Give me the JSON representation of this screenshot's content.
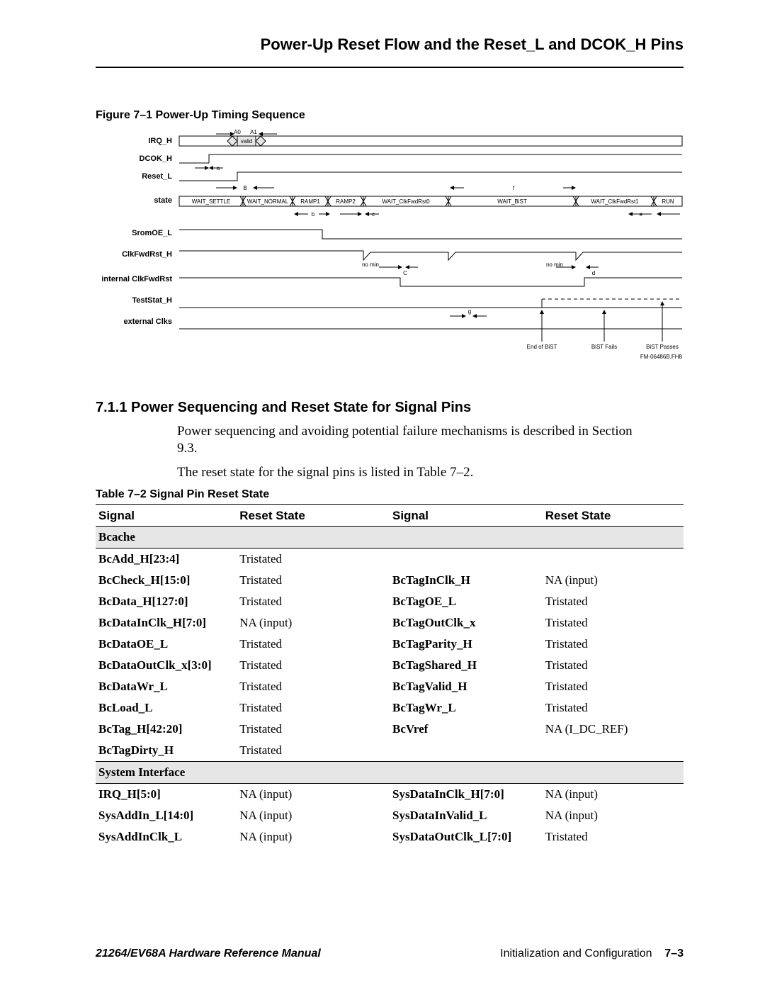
{
  "header": {
    "title": "Power-Up Reset Flow and the Reset_L and DCOK_H Pins"
  },
  "figure": {
    "caption": "Figure 7–1  Power-Up Timing Sequence",
    "signals": [
      "IRQ_H",
      "DCOK_H",
      "Reset_L",
      "state",
      "SromOE_L",
      "ClkFwdRst_H",
      "internal ClkFwdRst",
      "TestStat_H",
      "external Clks"
    ],
    "state_boxes": [
      "WAIT_SETTLE",
      "WAIT_NORMAL",
      "RAMP1",
      "RAMP2",
      "WAIT_ClkFwdRst0",
      "WAIT_BiST",
      "WAIT_ClkFwdRst1",
      "RUN"
    ],
    "irq_inner": "valid",
    "markers": {
      "A0": "A0",
      "A1": "A1",
      "a": "a",
      "B": "B",
      "b": "b",
      "c": "c",
      "C": "C",
      "d": "d",
      "e": "e",
      "f": "f",
      "g": "g",
      "nomin": "no min"
    },
    "callouts": {
      "eob": "End of BiST",
      "fail": "BiST Fails",
      "pass": "BiST Passes"
    },
    "tag": "FM-06486B.FH8"
  },
  "section": {
    "number_title": "7.1.1  Power Sequencing and Reset State for Signal Pins",
    "para1a": "Power sequencing and avoiding potential failure mechanisms is described in Section ",
    "para1b": "9.3.",
    "para2": "The reset state for the signal pins is listed in Table 7–2."
  },
  "table": {
    "caption": "Table 7–2  Signal Pin Reset State",
    "headers": [
      "Signal",
      "Reset State",
      "Signal",
      "Reset State"
    ],
    "groups": {
      "bcache": "Bcache",
      "sysif": "System Interface"
    },
    "rows_bcache": [
      [
        "BcAdd_H[23:4]",
        "Tristated",
        "",
        ""
      ],
      [
        "BcCheck_H[15:0]",
        "Tristated",
        "BcTagInClk_H",
        "NA (input)"
      ],
      [
        "BcData_H[127:0]",
        "Tristated",
        "BcTagOE_L",
        "Tristated"
      ],
      [
        "BcDataInClk_H[7:0]",
        "NA (input)",
        "BcTagOutClk_x",
        "Tristated"
      ],
      [
        "BcDataOE_L",
        "Tristated",
        "BcTagParity_H",
        "Tristated"
      ],
      [
        "BcDataOutClk_x[3:0]",
        "Tristated",
        "BcTagShared_H",
        "Tristated"
      ],
      [
        "BcDataWr_L",
        "Tristated",
        "BcTagValid_H",
        "Tristated"
      ],
      [
        "BcLoad_L",
        "Tristated",
        "BcTagWr_L",
        "Tristated"
      ],
      [
        "BcTag_H[42:20]",
        "Tristated",
        "BcVref",
        "NA (I_DC_REF)"
      ],
      [
        "BcTagDirty_H",
        "Tristated",
        "",
        ""
      ]
    ],
    "rows_sysif": [
      [
        "IRQ_H[5:0]",
        "NA (input)",
        "SysDataInClk_H[7:0]",
        "NA (input)"
      ],
      [
        "SysAddIn_L[14:0]",
        "NA (input)",
        "SysDataInValid_L",
        "NA (input)"
      ],
      [
        "SysAddInClk_L",
        "NA (input)",
        "SysDataOutClk_L[7:0]",
        "Tristated"
      ]
    ]
  },
  "footer": {
    "manual": "21264/EV68A Hardware Reference Manual",
    "chapter": "Initialization and Configuration",
    "page": "7–3"
  }
}
